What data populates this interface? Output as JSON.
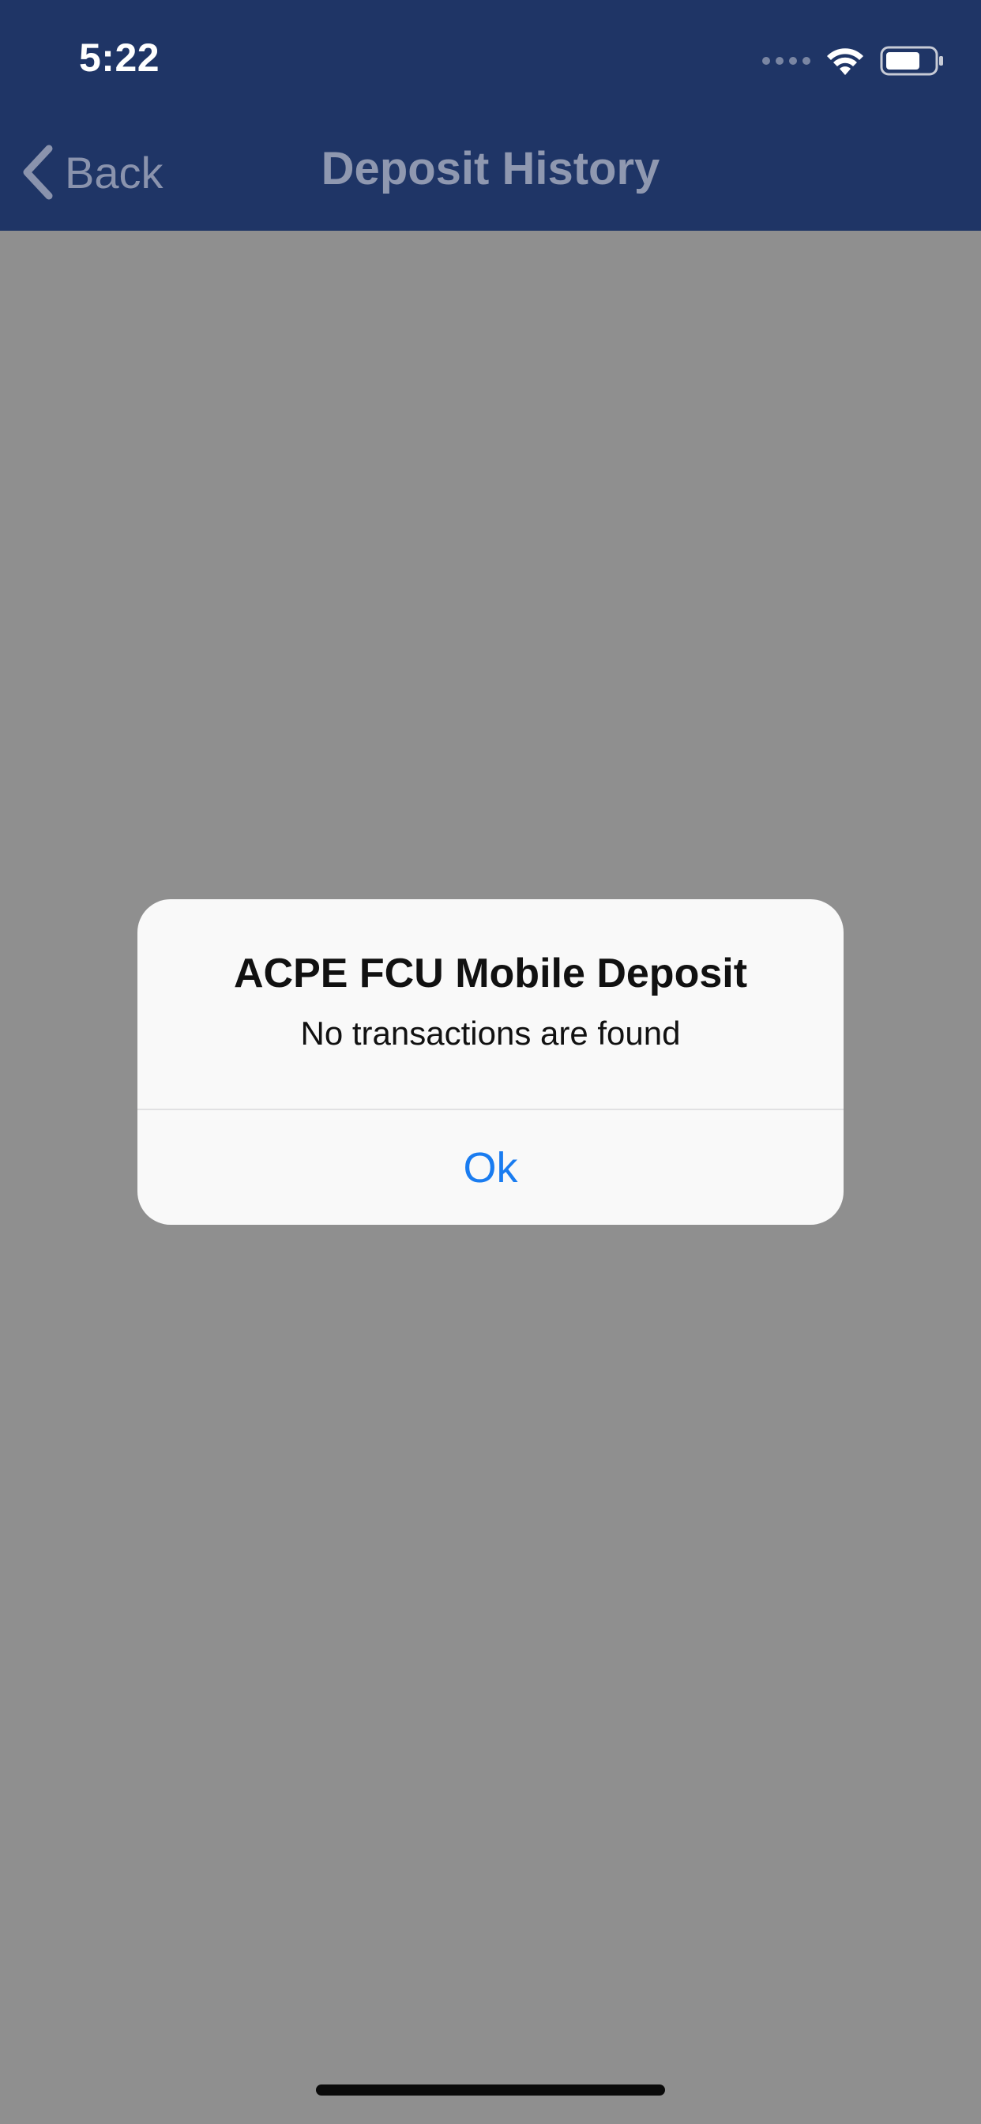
{
  "status_bar": {
    "time": "5:22",
    "icons": [
      "signal-dots-icon",
      "wifi-icon",
      "battery-icon"
    ]
  },
  "nav": {
    "back_label": "Back",
    "title": "Deposit History",
    "back_icon": "chevron-left-icon"
  },
  "alert": {
    "title": "ACPE FCU Mobile Deposit",
    "message": "No transactions are found",
    "button_label": "Ok"
  },
  "colors": {
    "nav_background": "#1f3566",
    "dimmed_background": "#8f8f8f",
    "alert_background": "#f9f9f9",
    "alert_button": "#1a7cf0"
  }
}
